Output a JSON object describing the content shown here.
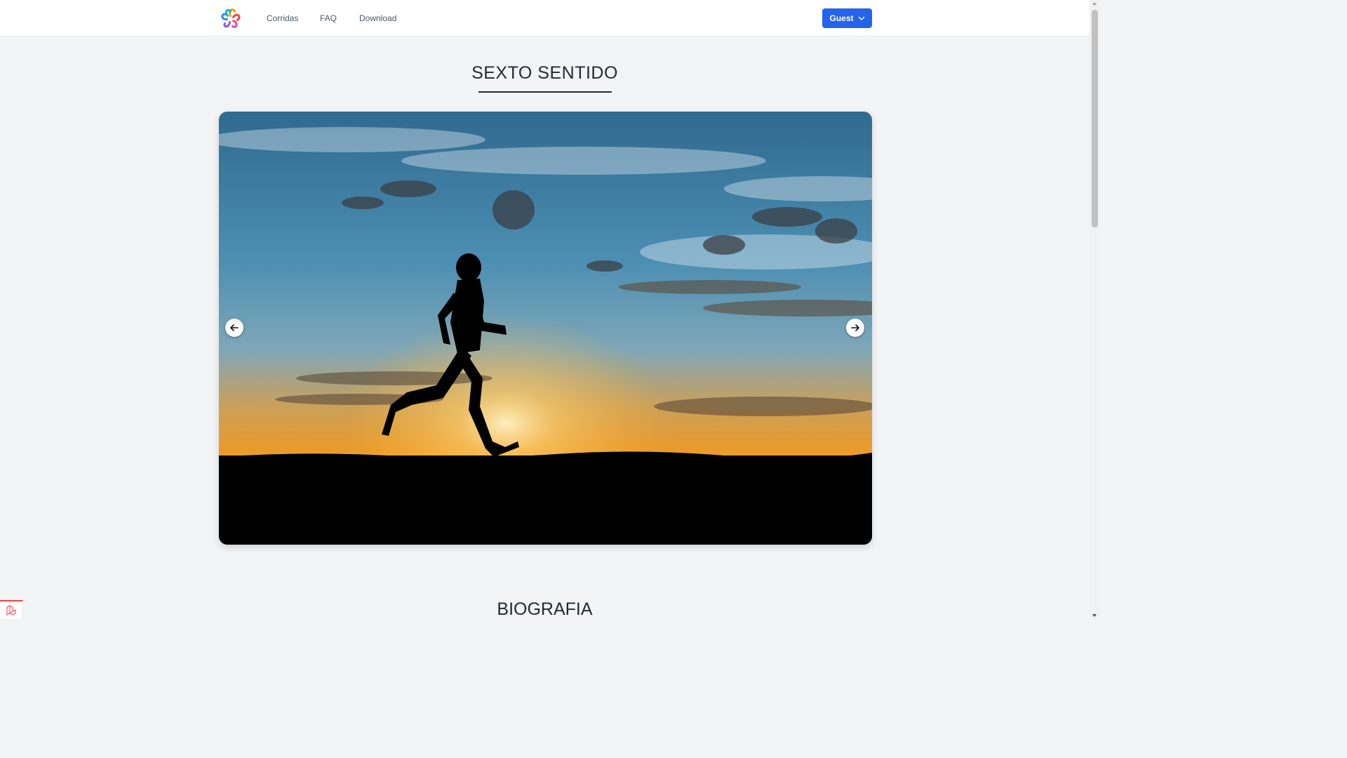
{
  "nav": {
    "logo_name": "flower-logo",
    "links": [
      {
        "label": "Corridas"
      },
      {
        "label": "FAQ"
      },
      {
        "label": "Download"
      }
    ],
    "user_menu": {
      "label": "Guest",
      "icon": "chevron-down-icon"
    }
  },
  "main": {
    "page_title": "SEXTO SENTIDO",
    "carousel": {
      "image_description_icon": "runner-sunset-photo",
      "prev_icon": "arrow-left-icon",
      "next_icon": "arrow-right-icon"
    },
    "section_title": "BIOGRAFIA"
  },
  "colors": {
    "primary": "#2563eb",
    "background": "#f3f4f6",
    "debug_accent": "#ef4444"
  }
}
